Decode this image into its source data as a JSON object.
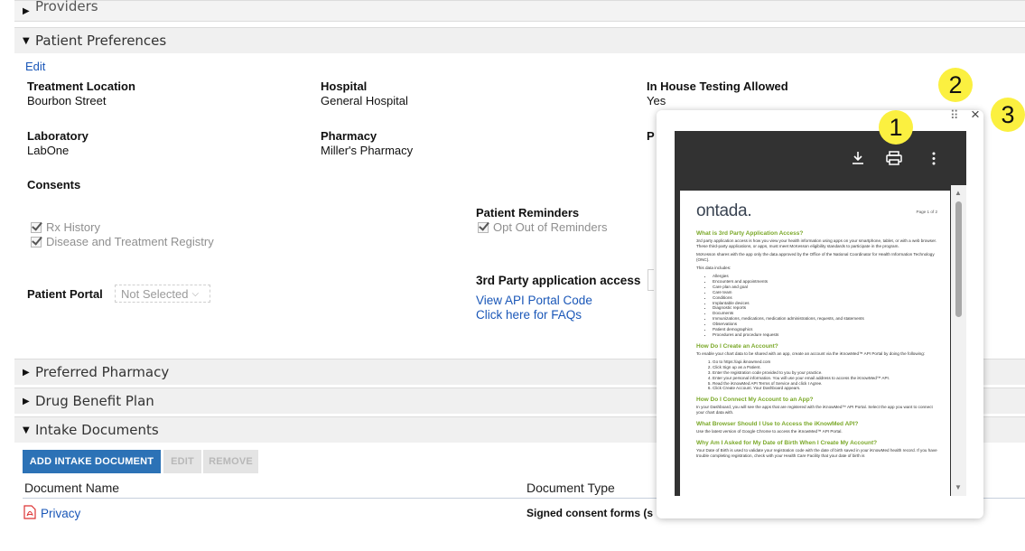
{
  "sections": {
    "providers": "Providers",
    "patient_preferences": "Patient Preferences",
    "preferred_pharmacy": "Preferred Pharmacy",
    "drug_benefit_plan": "Drug Benefit Plan",
    "intake_documents": "Intake Documents"
  },
  "prefs": {
    "edit": "Edit",
    "treatment_location_label": "Treatment Location",
    "treatment_location_value": "Bourbon Street",
    "hospital_label": "Hospital",
    "hospital_value": "General Hospital",
    "in_house_label": "In House Testing Allowed",
    "in_house_value": "Yes",
    "laboratory_label": "Laboratory",
    "laboratory_value": "LabOne",
    "pharmacy_label": "Pharmacy",
    "pharmacy_value": "Miller's Pharmacy",
    "cut_label": "P",
    "consents_label": "Consents",
    "consent_rx": "Rx History",
    "consent_disease": "Disease and Treatment Registry",
    "reminders_label": "Patient Reminders",
    "reminders_opt_out": "Opt Out of Reminders",
    "portal_label": "Patient Portal",
    "portal_value": "Not Selected",
    "third_party_label": "3rd Party application access",
    "view_api": "View API Portal Code",
    "faqs": "Click here for FAQs"
  },
  "intake": {
    "add_button": "ADD INTAKE DOCUMENT",
    "edit_button": "EDIT",
    "remove_button": "REMOVE",
    "col_name": "Document Name",
    "col_type": "Document Type",
    "row_name": "Privacy",
    "row_type": "Signed consent forms (s"
  },
  "popup": {
    "close": "×",
    "drag": "⠿"
  },
  "callouts": [
    "1",
    "2",
    "3"
  ],
  "pdf": {
    "logo": "ontada.",
    "page": "Page 1 of 2",
    "h1": "What is 3rd Party Application Access?",
    "p1": "3rd party application access is how you view your health information using apps on your smartphone, tablet, or with a web browser. These third-party applications, or apps, must meet McKesson eligibility standards to participate in the program.",
    "p2": "McKesson shares with the app only the data approved by the Office of the National Coordinator for Health Information Technology (ONC).",
    "p3": "This data includes:",
    "list": [
      "Allergies",
      "Encounters and appointments",
      "Care plan and goal",
      "Care team",
      "Conditions",
      "Implantable devices",
      "Diagnostic reports",
      "Documents",
      "Immunizations, medications, medication administrations, requests, and statements",
      "Observations",
      "Patient demographics",
      "Procedures and procedure requests"
    ],
    "h2": "How Do I Create an Account?",
    "p4": "To enable your chart data to be shared with an app, create an account via the iKnowMed™ API Portal by doing the following:",
    "steps": [
      "Go to https://api.iknowmed.com",
      "Click Sign up as a Patient.",
      "Enter the registration code provided to you by your practice.",
      "Enter your personal information. You will use your email address to access the iKnowMed™ API.",
      "Read the iKnowMed API Terms of Service and click I Agree.",
      "Click Create Account. Your Dashboard appears."
    ],
    "h3": "How Do I Connect My Account to an App?",
    "p5": "In your Dashboard, you will see the apps that are registered with the iKnowMed™ API Portal. Select the app you want to connect your chart data with.",
    "h4": "What Browser Should I Use to Access the iKnowMed API?",
    "p6": "Use the latest version of Google Chrome to access the iKnowMed™ API Portal.",
    "h5": "Why Am I Asked for My Date of Birth When I Create My Account?",
    "p7": "Your Date of Birth is used to validate your registration code with the date of birth saved in your iKnowMed health record. If you have trouble completing registration, check with your Health Care Facility that your date of birth is"
  }
}
